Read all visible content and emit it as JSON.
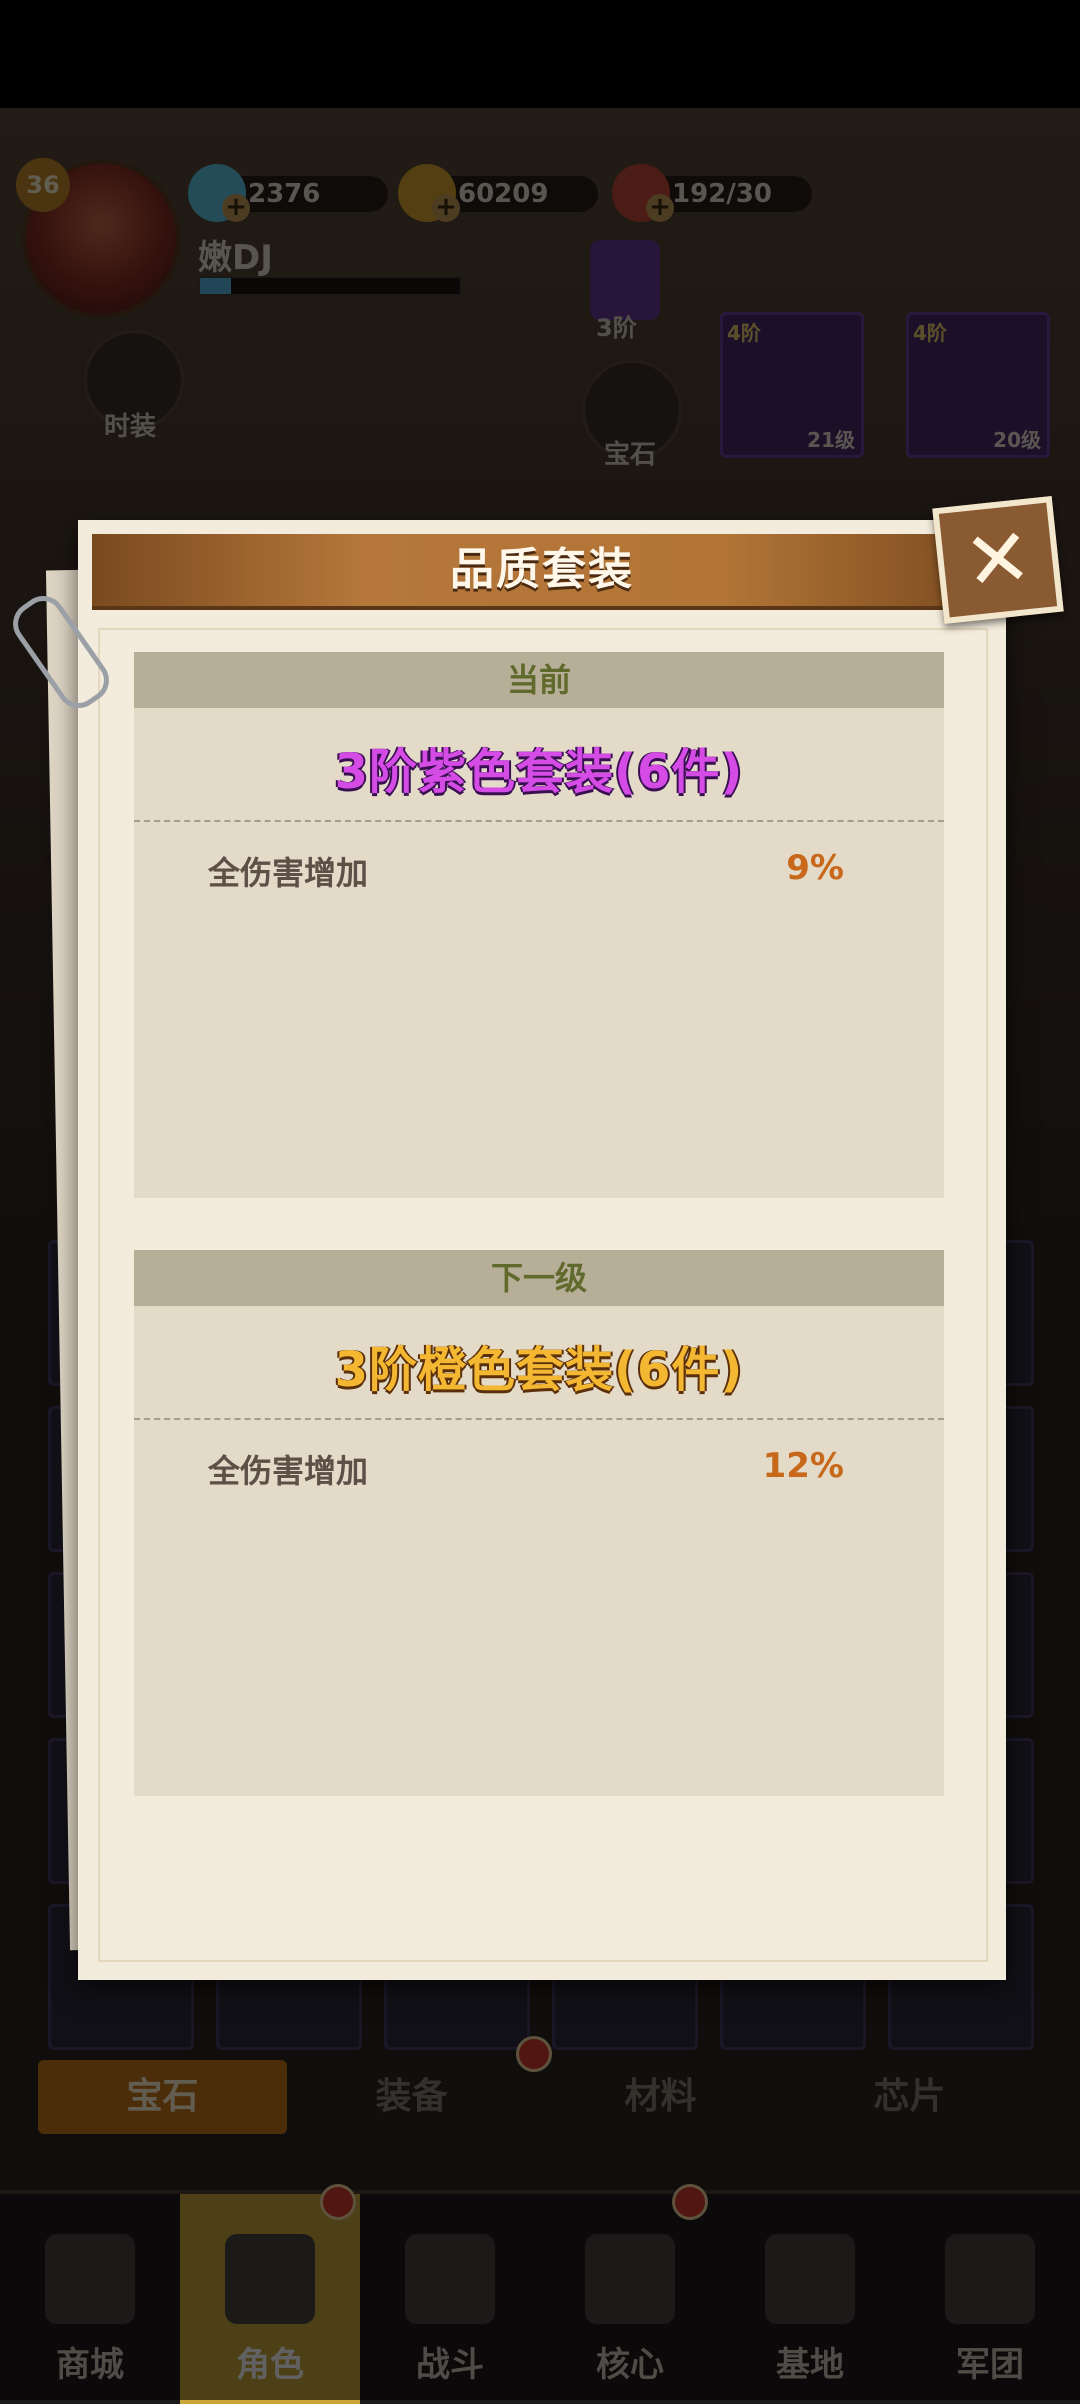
{
  "player": {
    "level": "36",
    "name": "嫩DJ",
    "xp_progress_percent": 12,
    "rank_label": "3阶"
  },
  "resources": [
    {
      "name": "diamond-icon",
      "value": "2376",
      "color": "#5ec7e8"
    },
    {
      "name": "coin-icon",
      "value": "60209",
      "color": "#d9a531"
    },
    {
      "name": "meat-icon",
      "value": "192/30",
      "color": "#c94a3a"
    }
  ],
  "side_buttons": {
    "fashion": "时装",
    "gem": "宝石"
  },
  "equipment": [
    {
      "tier": "4阶",
      "level": "21级"
    },
    {
      "tier": "4阶",
      "level": "20级"
    }
  ],
  "tabs": [
    {
      "label": "宝石",
      "active": true
    },
    {
      "label": "装备",
      "active": false
    },
    {
      "label": "材料",
      "active": false
    },
    {
      "label": "芯片",
      "active": false
    }
  ],
  "nav": [
    {
      "label": "商城",
      "icon": "shop-icon"
    },
    {
      "label": "角色",
      "icon": "character-icon",
      "active": true
    },
    {
      "label": "战斗",
      "icon": "battle-icon"
    },
    {
      "label": "核心",
      "icon": "core-icon"
    },
    {
      "label": "基地",
      "icon": "base-icon"
    },
    {
      "label": "军团",
      "icon": "legion-icon"
    }
  ],
  "modal": {
    "title": "品质套装",
    "close_icon": "close-icon",
    "current": {
      "header": "当前",
      "set_name": "3阶紫色套装(6件)",
      "stat_name": "全伤害增加",
      "stat_value": "9%"
    },
    "next": {
      "header": "下一级",
      "set_name": "3阶橙色套装(6件)",
      "stat_name": "全伤害增加",
      "stat_value": "12%"
    }
  }
}
